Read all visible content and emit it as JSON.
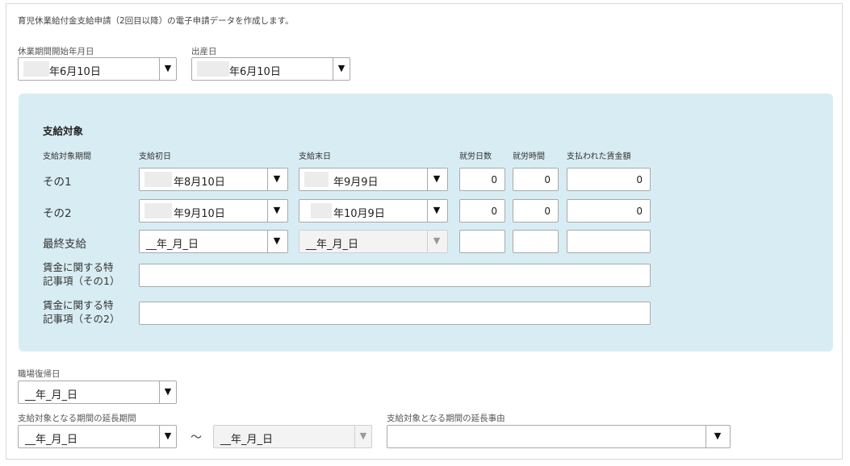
{
  "intro_text": "育児休業給付金支給申請（2回目以降）の電子申請データを作成します。",
  "leave_start": {
    "label": "休業期間開始年月日",
    "value": "年6月10日",
    "value_partial": "5年6月10日"
  },
  "birth_date": {
    "label": "出産日",
    "value": "年6月10日"
  },
  "payment": {
    "title": "支給対象",
    "headers": {
      "period": "支給対象期間",
      "start": "支給初日",
      "end": "支給末日",
      "work_days": "就労日数",
      "work_hours": "就労時間",
      "wages": "支払われた賃金額"
    },
    "rows": [
      {
        "label": "その1",
        "start": "年8月10日",
        "end": "年9月9日",
        "work_days": "0",
        "work_hours": "0",
        "wages": "0"
      },
      {
        "label": "その2",
        "start": "年9月10日",
        "end": "年10月9日",
        "work_days": "0",
        "work_hours": "0",
        "wages": "0"
      },
      {
        "label": "最終支給",
        "start": "__年_月_日",
        "end": "__年_月_日",
        "work_days": "",
        "work_hours": "",
        "wages": ""
      }
    ],
    "notes": [
      {
        "label_line1": "賃金に関する特",
        "label_line2": "記事項（その1）"
      },
      {
        "label_line1": "賃金に関する特",
        "label_line2": "記事項（その2）"
      }
    ]
  },
  "return_date": {
    "label": "職場復帰日",
    "value": "__年_月_日"
  },
  "extension_period": {
    "label": "支給対象となる期間の延長期間",
    "from": "__年_月_日",
    "separator": "～",
    "to": "__年_月_日"
  },
  "extension_reason": {
    "label": "支給対象となる期間の延長事由",
    "value": ""
  },
  "icons": {
    "dropdown": "dropdown-arrow-icon",
    "arrow_glyph": "▼"
  }
}
